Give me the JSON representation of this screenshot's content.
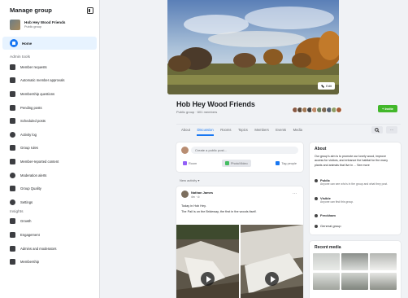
{
  "sidebar": {
    "title": "Manage group",
    "group_name": "Hob Hey Wood Friends",
    "group_privacy": "Public group",
    "home_label": "Home",
    "admin_tools_label": "Admin tools",
    "admin_items": [
      {
        "label": "Member requests",
        "icon": "member-requests-icon"
      },
      {
        "label": "Automatic member approvals",
        "icon": "auto-approve-icon"
      },
      {
        "label": "Membership questions",
        "icon": "questions-icon"
      },
      {
        "label": "Pending posts",
        "icon": "pending-posts-icon"
      },
      {
        "label": "Scheduled posts",
        "icon": "calendar-icon"
      },
      {
        "label": "Activity log",
        "icon": "clock-icon"
      },
      {
        "label": "Group rules",
        "icon": "rules-icon"
      },
      {
        "label": "Member-reported content",
        "icon": "flag-icon"
      },
      {
        "label": "Moderation alerts",
        "icon": "alert-icon"
      },
      {
        "label": "Group Quality",
        "icon": "quality-icon"
      },
      {
        "label": "Settings",
        "icon": "gear-icon"
      }
    ],
    "insights_label": "Insights",
    "insight_items": [
      {
        "label": "Growth",
        "icon": "growth-icon"
      },
      {
        "label": "Engagement",
        "icon": "engagement-icon"
      },
      {
        "label": "Admins and moderators",
        "icon": "admins-icon"
      },
      {
        "label": "Membership",
        "icon": "membership-icon"
      }
    ]
  },
  "group": {
    "name": "Hob Hey Wood Friends",
    "meta": "Public group · 601 members",
    "edit_label": "Edit",
    "invite_label": "+ Invite"
  },
  "tabs": [
    "About",
    "Discussion",
    "Rooms",
    "Topics",
    "Members",
    "Events",
    "Media"
  ],
  "tabs_more_label": "···",
  "composer": {
    "placeholder": "Create a public post...",
    "actions": [
      {
        "label": "Room",
        "color": "#9360f7"
      },
      {
        "label": "Photo/Video",
        "color": "#45bd62"
      },
      {
        "label": "Tag people",
        "color": "#1877f2"
      }
    ]
  },
  "new_activity_label": "New activity ▾",
  "post": {
    "author": "Nathan James",
    "time": "4m · ⊙",
    "line1": "Today in Hob Hey.",
    "line2": "The Pail is on the Brideway, the first in the woods itself."
  },
  "about": {
    "title": "About",
    "description": "Our group's aim is to promote our lovely wood, improve access for visitors, and enhance the habitat for the many plants and animals that live in ... See more",
    "rows": [
      {
        "label": "Public",
        "sub": "Anyone can see who's in the group and what they post."
      },
      {
        "label": "Visible",
        "sub": "Anyone can find this group."
      },
      {
        "label": "Freckham",
        "sub": ""
      },
      {
        "label": "General group",
        "sub": ""
      }
    ]
  },
  "media_title": "Recent media",
  "colors": {
    "accent": "#1877f2",
    "invite": "#42b72a"
  }
}
